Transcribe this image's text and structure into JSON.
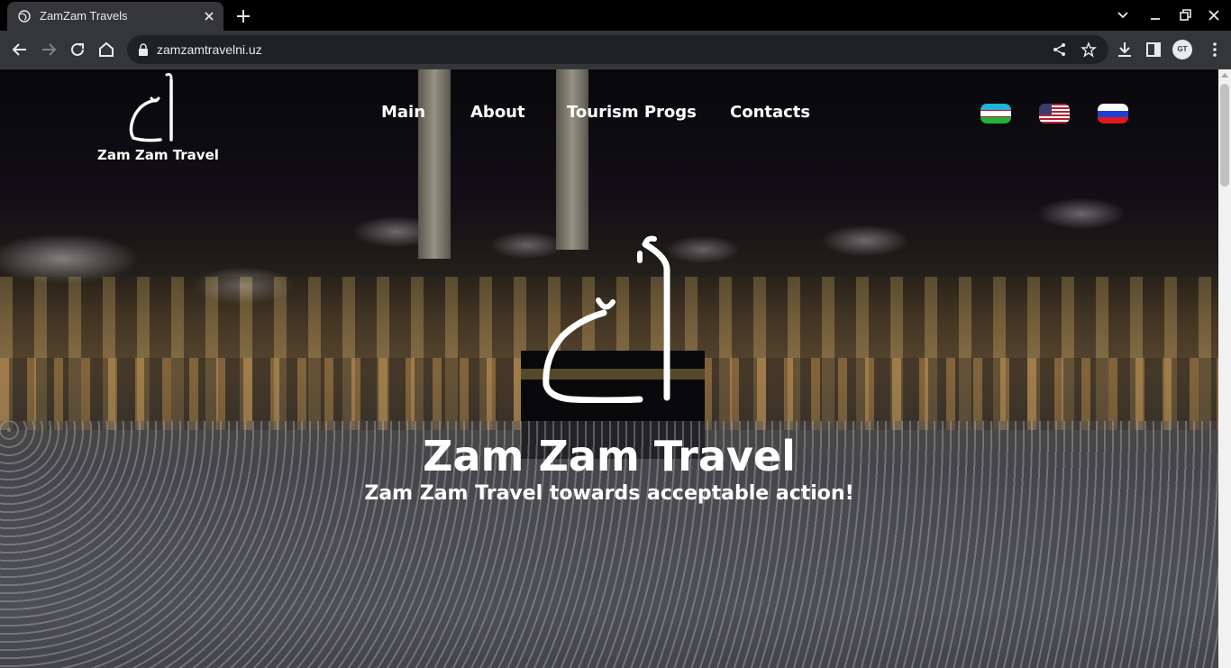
{
  "browser": {
    "tab_title": "ZamZam Travels",
    "url": "zamzamtravelni.uz",
    "profile_initials": "GT"
  },
  "site": {
    "logo_text": "Zam Zam Travel",
    "nav": [
      "Main",
      "About",
      "Tourism Progs",
      "Contacts"
    ],
    "languages": [
      "uzbekistan-flag",
      "usa-flag",
      "russia-flag"
    ],
    "hero_title": "Zam Zam Travel",
    "hero_subtitle": "Zam Zam Travel towards acceptable action!"
  },
  "colors": {
    "chrome_bg": "#35363a",
    "tabstrip_bg": "#000000",
    "text_white": "#ffffff"
  }
}
